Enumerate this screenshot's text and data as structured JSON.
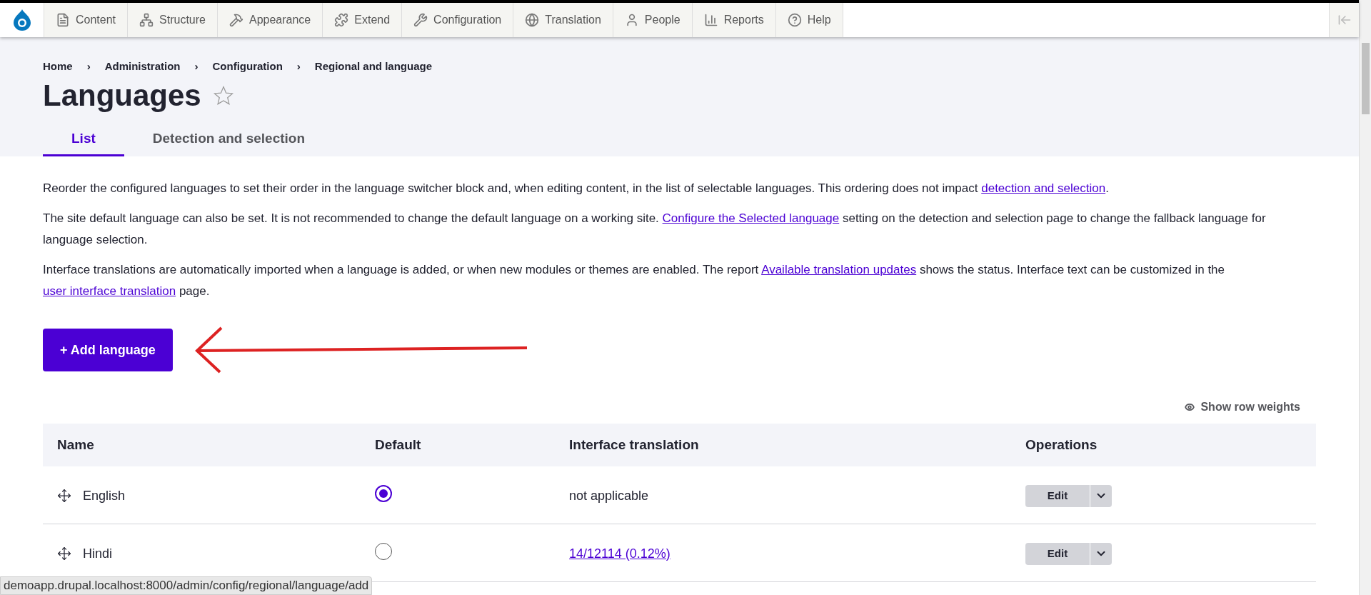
{
  "toolbar": {
    "items": [
      {
        "label": "Content",
        "kind": "content"
      },
      {
        "label": "Structure",
        "kind": "structure"
      },
      {
        "label": "Appearance",
        "kind": "appearance"
      },
      {
        "label": "Extend",
        "kind": "extend"
      },
      {
        "label": "Configuration",
        "kind": "configuration"
      },
      {
        "label": "Translation",
        "kind": "translation"
      },
      {
        "label": "People",
        "kind": "people"
      },
      {
        "label": "Reports",
        "kind": "reports"
      },
      {
        "label": "Help",
        "kind": "help"
      }
    ]
  },
  "breadcrumb": {
    "separator": "›",
    "items": [
      "Home",
      "Administration",
      "Configuration",
      "Regional and language"
    ]
  },
  "page_title": "Languages",
  "tabs": [
    {
      "label": "List",
      "selected": true
    },
    {
      "label": "Detection and selection",
      "selected": false
    }
  ],
  "paragraphs": [
    [
      {
        "kind": "text",
        "text": "Reorder the configured languages to set their order in the language switcher block and, when editing content, in the list of selectable languages. This ordering does not impact "
      },
      {
        "kind": "link",
        "text": "detection and selection"
      },
      {
        "kind": "text",
        "text": "."
      }
    ],
    [
      {
        "kind": "text",
        "text": "The site default language can also be set. It is not recommended to change the default language on a working site. "
      },
      {
        "kind": "link",
        "text": "Configure the Selected language"
      },
      {
        "kind": "text",
        "text": " setting on the detection and selection page to change the fallback language for language selection."
      }
    ],
    [
      {
        "kind": "text",
        "text": "Interface translations are automatically imported when a language is added, or when new modules or themes are enabled. The report "
      },
      {
        "kind": "link",
        "text": "Available translation updates"
      },
      {
        "kind": "text",
        "text": " shows the status. Interface text can be customized in the "
      },
      {
        "kind": "link",
        "text": "user interface translation"
      },
      {
        "kind": "text",
        "text": " page."
      }
    ]
  ],
  "add_button": "+ Add language",
  "show_row_weights": "Show row weights",
  "table": {
    "columns": [
      "Name",
      "Default",
      "Interface translation",
      "Operations"
    ],
    "rows": [
      {
        "name": "English",
        "selected": true,
        "translation": "not applicable",
        "kind": "text",
        "operation": "Edit"
      },
      {
        "name": "Hindi",
        "selected": false,
        "translation": "14/12114 (0.12%)",
        "kind": "link",
        "operation": "Edit"
      }
    ]
  },
  "status_url": "demoapp.drupal.localhost:8000/admin/config/regional/language/add"
}
